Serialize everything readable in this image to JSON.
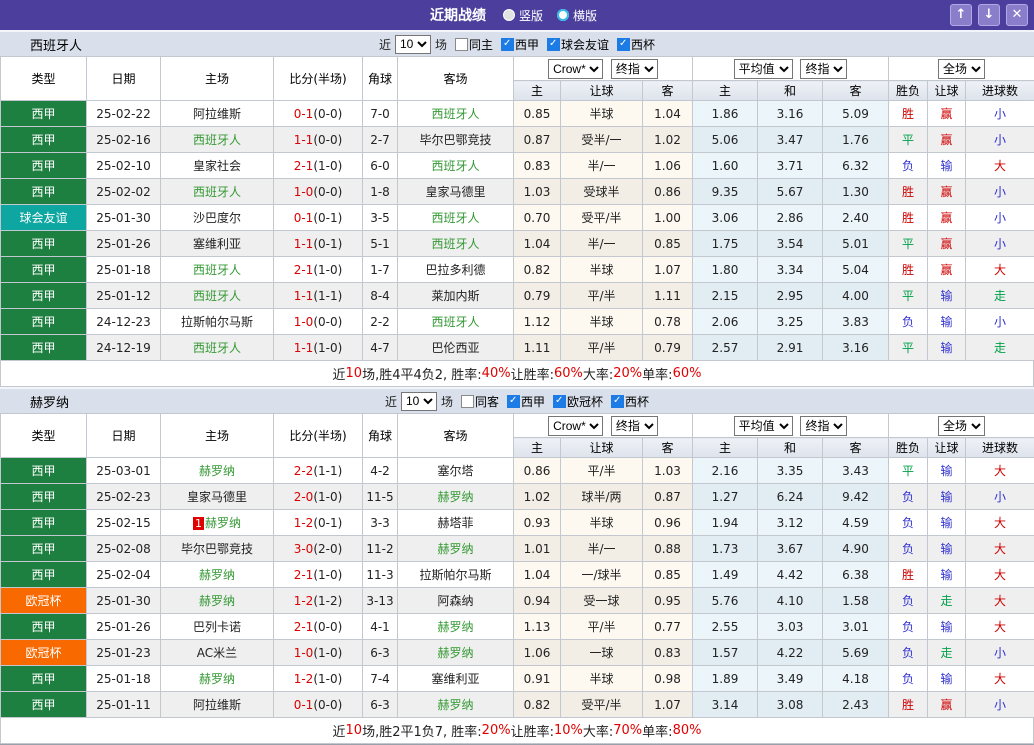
{
  "palette": {
    "vars": {
      "titlebar": "#4b3e9d",
      "btn": "#8a7ecb",
      "hl": "#339933",
      "score": "#dd0000",
      "red": "#cf0000",
      "green": "#00a048",
      "blue": "#3030d0"
    },
    "league": {
      "liga": "#1e8040",
      "friendly": "#0da6a0",
      "ucl": "#f86900"
    }
  },
  "titlebar": {
    "title": "近期战绩",
    "radios": [
      {
        "label": "竖版",
        "selected": true
      },
      {
        "label": "横版",
        "selected": false
      }
    ],
    "buttons": {
      "up": "↑",
      "down": "↓",
      "close": "✕"
    }
  },
  "columns": {
    "type": "类型",
    "date": "日期",
    "home": "主场",
    "score": "比分(半场)",
    "corner": "角球",
    "away": "客场",
    "dropdowns": {
      "crow": "Crow*",
      "final1": "终指",
      "avg": "平均值",
      "final2": "终指",
      "scope": "全场"
    },
    "sub": [
      "主",
      "让球",
      "客",
      "主",
      "和",
      "客",
      "胜负",
      "让球",
      "进球数"
    ]
  },
  "sections": [
    {
      "team": "西班牙人",
      "filter": {
        "prefix": "近",
        "count": "10",
        "suffix": "场",
        "checks": [
          {
            "checked": false,
            "label": "同主"
          },
          {
            "checked": true,
            "label": "西甲"
          },
          {
            "checked": true,
            "label": "球会友谊"
          },
          {
            "checked": true,
            "label": "西杯"
          }
        ]
      },
      "rows": [
        {
          "league": "西甲",
          "league_key": "liga",
          "date": "25-02-22",
          "home": "阿拉维斯",
          "home_hl": false,
          "home_badge": "",
          "score": "0-1",
          "half": "(0-0)",
          "corners": "7-0",
          "away": "西班牙人",
          "away_hl": true,
          "o1": "0.85",
          "hcp": "半球",
          "o2": "1.04",
          "a1": "1.86",
          "a2": "3.16",
          "a3": "5.09",
          "r1": "胜",
          "r1c": "red",
          "r2": "赢",
          "r2c": "red",
          "r3": "小",
          "r3c": "blue"
        },
        {
          "league": "西甲",
          "league_key": "liga",
          "date": "25-02-16",
          "home": "西班牙人",
          "home_hl": true,
          "home_badge": "",
          "score": "1-1",
          "half": "(0-0)",
          "corners": "2-7",
          "away": "毕尔巴鄂竞技",
          "away_hl": false,
          "o1": "0.87",
          "hcp": "受半/一",
          "o2": "1.02",
          "a1": "5.06",
          "a2": "3.47",
          "a3": "1.76",
          "r1": "平",
          "r1c": "green",
          "r2": "赢",
          "r2c": "red",
          "r3": "小",
          "r3c": "blue"
        },
        {
          "league": "西甲",
          "league_key": "liga",
          "date": "25-02-10",
          "home": "皇家社会",
          "home_hl": false,
          "home_badge": "",
          "score": "2-1",
          "half": "(1-0)",
          "corners": "6-0",
          "away": "西班牙人",
          "away_hl": true,
          "o1": "0.83",
          "hcp": "半/一",
          "o2": "1.06",
          "a1": "1.60",
          "a2": "3.71",
          "a3": "6.32",
          "r1": "负",
          "r1c": "blue",
          "r2": "输",
          "r2c": "blue",
          "r3": "大",
          "r3c": "red"
        },
        {
          "league": "西甲",
          "league_key": "liga",
          "date": "25-02-02",
          "home": "西班牙人",
          "home_hl": true,
          "home_badge": "",
          "score": "1-0",
          "half": "(0-0)",
          "corners": "1-8",
          "away": "皇家马德里",
          "away_hl": false,
          "o1": "1.03",
          "hcp": "受球半",
          "o2": "0.86",
          "a1": "9.35",
          "a2": "5.67",
          "a3": "1.30",
          "r1": "胜",
          "r1c": "red",
          "r2": "赢",
          "r2c": "red",
          "r3": "小",
          "r3c": "blue"
        },
        {
          "league": "球会友谊",
          "league_key": "friendly",
          "date": "25-01-30",
          "home": "沙巴度尔",
          "home_hl": false,
          "home_badge": "",
          "score": "0-1",
          "half": "(0-1)",
          "corners": "3-5",
          "away": "西班牙人",
          "away_hl": true,
          "o1": "0.70",
          "hcp": "受平/半",
          "o2": "1.00",
          "a1": "3.06",
          "a2": "2.86",
          "a3": "2.40",
          "r1": "胜",
          "r1c": "red",
          "r2": "赢",
          "r2c": "red",
          "r3": "小",
          "r3c": "blue"
        },
        {
          "league": "西甲",
          "league_key": "liga",
          "date": "25-01-26",
          "home": "塞维利亚",
          "home_hl": false,
          "home_badge": "",
          "score": "1-1",
          "half": "(0-1)",
          "corners": "5-1",
          "away": "西班牙人",
          "away_hl": true,
          "o1": "1.04",
          "hcp": "半/一",
          "o2": "0.85",
          "a1": "1.75",
          "a2": "3.54",
          "a3": "5.01",
          "r1": "平",
          "r1c": "green",
          "r2": "赢",
          "r2c": "red",
          "r3": "小",
          "r3c": "blue"
        },
        {
          "league": "西甲",
          "league_key": "liga",
          "date": "25-01-18",
          "home": "西班牙人",
          "home_hl": true,
          "home_badge": "",
          "score": "2-1",
          "half": "(1-0)",
          "corners": "1-7",
          "away": "巴拉多利德",
          "away_hl": false,
          "o1": "0.82",
          "hcp": "半球",
          "o2": "1.07",
          "a1": "1.80",
          "a2": "3.34",
          "a3": "5.04",
          "r1": "胜",
          "r1c": "red",
          "r2": "赢",
          "r2c": "red",
          "r3": "大",
          "r3c": "red"
        },
        {
          "league": "西甲",
          "league_key": "liga",
          "date": "25-01-12",
          "home": "西班牙人",
          "home_hl": true,
          "home_badge": "",
          "score": "1-1",
          "half": "(1-1)",
          "corners": "8-4",
          "away": "莱加内斯",
          "away_hl": false,
          "o1": "0.79",
          "hcp": "平/半",
          "o2": "1.11",
          "a1": "2.15",
          "a2": "2.95",
          "a3": "4.00",
          "r1": "平",
          "r1c": "green",
          "r2": "输",
          "r2c": "blue",
          "r3": "走",
          "r3c": "green"
        },
        {
          "league": "西甲",
          "league_key": "liga",
          "date": "24-12-23",
          "home": "拉斯帕尔马斯",
          "home_hl": false,
          "home_badge": "",
          "score": "1-0",
          "half": "(0-0)",
          "corners": "2-2",
          "away": "西班牙人",
          "away_hl": true,
          "o1": "1.12",
          "hcp": "半球",
          "o2": "0.78",
          "a1": "2.06",
          "a2": "3.25",
          "a3": "3.83",
          "r1": "负",
          "r1c": "blue",
          "r2": "输",
          "r2c": "blue",
          "r3": "小",
          "r3c": "blue"
        },
        {
          "league": "西甲",
          "league_key": "liga",
          "date": "24-12-19",
          "home": "西班牙人",
          "home_hl": true,
          "home_badge": "",
          "score": "1-1",
          "half": "(1-0)",
          "corners": "4-7",
          "away": "巴伦西亚",
          "away_hl": false,
          "o1": "1.11",
          "hcp": "平/半",
          "o2": "0.79",
          "a1": "2.57",
          "a2": "2.91",
          "a3": "3.16",
          "r1": "平",
          "r1c": "green",
          "r2": "输",
          "r2c": "blue",
          "r3": "走",
          "r3c": "green"
        }
      ],
      "summary_parts": [
        "近",
        "10",
        "场,胜4平4负2, 胜率:",
        "40%",
        " 让胜率:",
        "60%",
        " 大率:",
        "20%",
        " 单率:",
        "60%"
      ]
    },
    {
      "team": "赫罗纳",
      "filter": {
        "prefix": "近",
        "count": "10",
        "suffix": "场",
        "checks": [
          {
            "checked": false,
            "label": "同客"
          },
          {
            "checked": true,
            "label": "西甲"
          },
          {
            "checked": true,
            "label": "欧冠杯"
          },
          {
            "checked": true,
            "label": "西杯"
          }
        ]
      },
      "rows": [
        {
          "league": "西甲",
          "league_key": "liga",
          "date": "25-03-01",
          "home": "赫罗纳",
          "home_hl": true,
          "home_badge": "",
          "score": "2-2",
          "half": "(1-1)",
          "corners": "4-2",
          "away": "塞尔塔",
          "away_hl": false,
          "o1": "0.86",
          "hcp": "平/半",
          "o2": "1.03",
          "a1": "2.16",
          "a2": "3.35",
          "a3": "3.43",
          "r1": "平",
          "r1c": "green",
          "r2": "输",
          "r2c": "blue",
          "r3": "大",
          "r3c": "red"
        },
        {
          "league": "西甲",
          "league_key": "liga",
          "date": "25-02-23",
          "home": "皇家马德里",
          "home_hl": false,
          "home_badge": "",
          "score": "2-0",
          "half": "(1-0)",
          "corners": "11-5",
          "away": "赫罗纳",
          "away_hl": true,
          "o1": "1.02",
          "hcp": "球半/两",
          "o2": "0.87",
          "a1": "1.27",
          "a2": "6.24",
          "a3": "9.42",
          "r1": "负",
          "r1c": "blue",
          "r2": "输",
          "r2c": "blue",
          "r3": "小",
          "r3c": "blue"
        },
        {
          "league": "西甲",
          "league_key": "liga",
          "date": "25-02-15",
          "home": "赫罗纳",
          "home_hl": true,
          "home_badge": "1",
          "score": "1-2",
          "half": "(0-1)",
          "corners": "3-3",
          "away": "赫塔菲",
          "away_hl": false,
          "o1": "0.93",
          "hcp": "半球",
          "o2": "0.96",
          "a1": "1.94",
          "a2": "3.12",
          "a3": "4.59",
          "r1": "负",
          "r1c": "blue",
          "r2": "输",
          "r2c": "blue",
          "r3": "大",
          "r3c": "red"
        },
        {
          "league": "西甲",
          "league_key": "liga",
          "date": "25-02-08",
          "home": "毕尔巴鄂竞技",
          "home_hl": false,
          "home_badge": "",
          "score": "3-0",
          "half": "(2-0)",
          "corners": "11-2",
          "away": "赫罗纳",
          "away_hl": true,
          "o1": "1.01",
          "hcp": "半/一",
          "o2": "0.88",
          "a1": "1.73",
          "a2": "3.67",
          "a3": "4.90",
          "r1": "负",
          "r1c": "blue",
          "r2": "输",
          "r2c": "blue",
          "r3": "大",
          "r3c": "red"
        },
        {
          "league": "西甲",
          "league_key": "liga",
          "date": "25-02-04",
          "home": "赫罗纳",
          "home_hl": true,
          "home_badge": "",
          "score": "2-1",
          "half": "(1-0)",
          "corners": "11-3",
          "away": "拉斯帕尔马斯",
          "away_hl": false,
          "o1": "1.04",
          "hcp": "一/球半",
          "o2": "0.85",
          "a1": "1.49",
          "a2": "4.42",
          "a3": "6.38",
          "r1": "胜",
          "r1c": "red",
          "r2": "输",
          "r2c": "blue",
          "r3": "大",
          "r3c": "red"
        },
        {
          "league": "欧冠杯",
          "league_key": "ucl",
          "date": "25-01-30",
          "home": "赫罗纳",
          "home_hl": true,
          "home_badge": "",
          "score": "1-2",
          "half": "(1-2)",
          "corners": "3-13",
          "away": "阿森纳",
          "away_hl": false,
          "o1": "0.94",
          "hcp": "受一球",
          "o2": "0.95",
          "a1": "5.76",
          "a2": "4.10",
          "a3": "1.58",
          "r1": "负",
          "r1c": "blue",
          "r2": "走",
          "r2c": "green",
          "r3": "大",
          "r3c": "red"
        },
        {
          "league": "西甲",
          "league_key": "liga",
          "date": "25-01-26",
          "home": "巴列卡诺",
          "home_hl": false,
          "home_badge": "",
          "score": "2-1",
          "half": "(0-0)",
          "corners": "4-1",
          "away": "赫罗纳",
          "away_hl": true,
          "o1": "1.13",
          "hcp": "平/半",
          "o2": "0.77",
          "a1": "2.55",
          "a2": "3.03",
          "a3": "3.01",
          "r1": "负",
          "r1c": "blue",
          "r2": "输",
          "r2c": "blue",
          "r3": "大",
          "r3c": "red"
        },
        {
          "league": "欧冠杯",
          "league_key": "ucl",
          "date": "25-01-23",
          "home": "AC米兰",
          "home_hl": false,
          "home_badge": "",
          "score": "1-0",
          "half": "(1-0)",
          "corners": "6-3",
          "away": "赫罗纳",
          "away_hl": true,
          "o1": "1.06",
          "hcp": "一球",
          "o2": "0.83",
          "a1": "1.57",
          "a2": "4.22",
          "a3": "5.69",
          "r1": "负",
          "r1c": "blue",
          "r2": "走",
          "r2c": "green",
          "r3": "小",
          "r3c": "blue"
        },
        {
          "league": "西甲",
          "league_key": "liga",
          "date": "25-01-18",
          "home": "赫罗纳",
          "home_hl": true,
          "home_badge": "",
          "score": "1-2",
          "half": "(1-0)",
          "corners": "7-4",
          "away": "塞维利亚",
          "away_hl": false,
          "o1": "0.91",
          "hcp": "半球",
          "o2": "0.98",
          "a1": "1.89",
          "a2": "3.49",
          "a3": "4.18",
          "r1": "负",
          "r1c": "blue",
          "r2": "输",
          "r2c": "blue",
          "r3": "大",
          "r3c": "red"
        },
        {
          "league": "西甲",
          "league_key": "liga",
          "date": "25-01-11",
          "home": "阿拉维斯",
          "home_hl": false,
          "home_badge": "",
          "score": "0-1",
          "half": "(0-0)",
          "corners": "6-3",
          "away": "赫罗纳",
          "away_hl": true,
          "o1": "0.82",
          "hcp": "受平/半",
          "o2": "1.07",
          "a1": "3.14",
          "a2": "3.08",
          "a3": "2.43",
          "r1": "胜",
          "r1c": "red",
          "r2": "赢",
          "r2c": "red",
          "r3": "小",
          "r3c": "blue"
        }
      ],
      "summary_parts": [
        "近",
        "10",
        "场,胜2平1负7, 胜率:",
        "20%",
        " 让胜率:",
        "10%",
        " 大率:",
        "70%",
        " 单率:",
        "80%"
      ]
    }
  ]
}
